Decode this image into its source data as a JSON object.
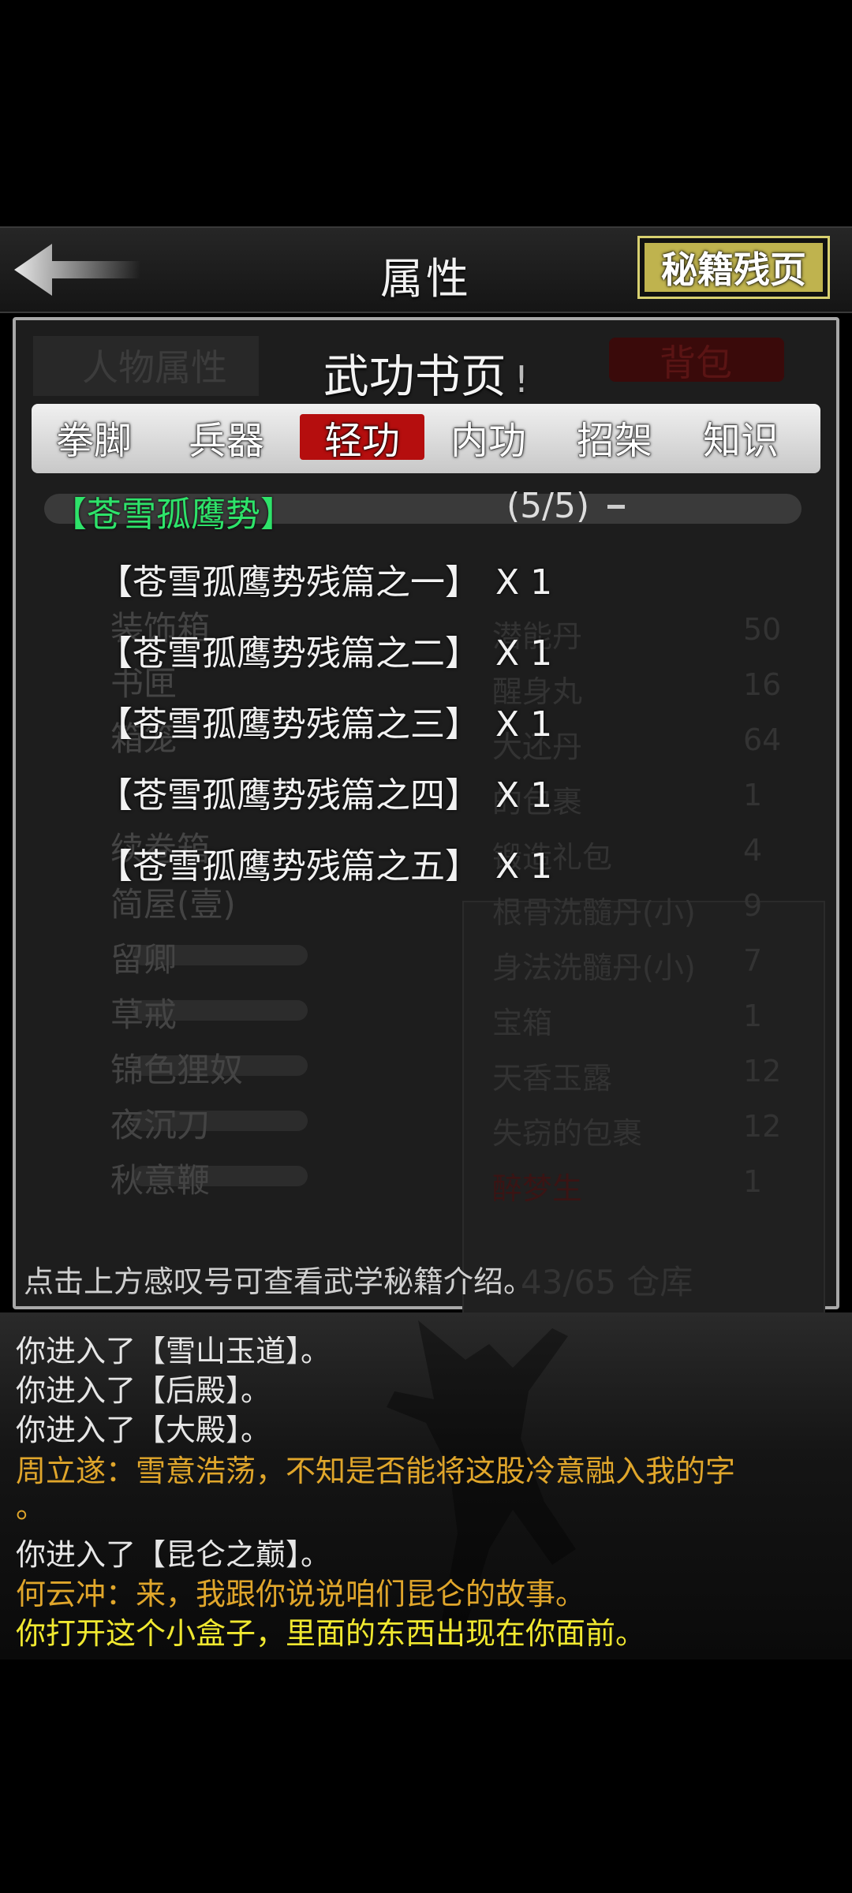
{
  "header": {
    "title": "属性",
    "corner_button": "秘籍残页"
  },
  "panel": {
    "ghost_tab_left": "人物属性",
    "ghost_tab_right": "背包",
    "title": "武功书页",
    "info_mark": "!",
    "tabs": [
      "拳脚",
      "兵器",
      "轻功",
      "内功",
      "招架",
      "知识"
    ],
    "active_tab_index": 2,
    "section": {
      "name": "【苍雪孤鹰势】",
      "count": "(5/5)"
    },
    "items": [
      {
        "name": "【苍雪孤鹰势残篇之一】",
        "qty": "X 1"
      },
      {
        "name": "【苍雪孤鹰势残篇之二】",
        "qty": "X 1"
      },
      {
        "name": "【苍雪孤鹰势残篇之三】",
        "qty": "X 1"
      },
      {
        "name": "【苍雪孤鹰势残篇之四】",
        "qty": "X 1"
      },
      {
        "name": "【苍雪孤鹰势残篇之五】",
        "qty": "X 1"
      }
    ],
    "hint": "点击上方感叹号可查看武学秘籍介绍。",
    "background_ghost": {
      "left_list": [
        "装饰箱",
        "书匣",
        "箱笼",
        "续卷箱",
        "简屋(壹)",
        "留卿",
        "草戒",
        "锦色狸奴",
        "夜沉刀",
        "秋意鞭"
      ],
      "right_list": [
        {
          "name": "潜能丹",
          "count": "50"
        },
        {
          "name": "醒身丸",
          "count": "16"
        },
        {
          "name": "大还丹",
          "count": "64"
        },
        {
          "name": "的包裹",
          "count": "1"
        },
        {
          "name": "锻造礼包",
          "count": "4"
        },
        {
          "name": "根骨洗髓丹(小)",
          "count": "9"
        },
        {
          "name": "身法洗髓丹(小)",
          "count": "7"
        },
        {
          "name": "宝箱",
          "count": "1"
        },
        {
          "name": "天香玉露",
          "count": "12"
        },
        {
          "name": "失窃的包裹",
          "count": "12"
        },
        {
          "name": "醉梦生",
          "count": "1"
        }
      ],
      "storage": "43/65 仓库"
    }
  },
  "log": {
    "lines": [
      {
        "text": "你进入了【雪山玉道】。",
        "color": "white"
      },
      {
        "text": "你进入了【后殿】。",
        "color": "white"
      },
      {
        "text": "你进入了【大殿】。",
        "color": "white"
      },
      {
        "text": "周立遂：雪意浩荡，不知是否能将这股冷意融入我的字",
        "color": "orange"
      },
      {
        "text": "。",
        "color": "orange"
      },
      {
        "text": "你进入了【昆仑之巅】。",
        "color": "white"
      },
      {
        "text": "何云冲：来，我跟你说说咱们昆仑的故事。",
        "color": "orange"
      },
      {
        "text": "你打开这个小盒子，里面的东西出现在你面前。",
        "color": "yellow"
      }
    ]
  },
  "colors": {
    "active_tab": "#b50e0e",
    "section_name": "#2ee36a",
    "accent_gold": "#bfb34e"
  }
}
